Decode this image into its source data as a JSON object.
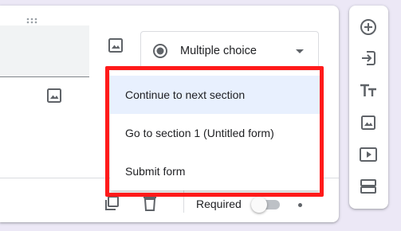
{
  "question": {
    "type_select": {
      "label": "Multiple choice"
    },
    "footer": {
      "required_label": "Required"
    }
  },
  "section_menu": {
    "items": [
      {
        "label": "Continue to next section",
        "selected": true
      },
      {
        "label": "Go to section 1 (Untitled form)",
        "selected": false
      },
      {
        "label": "Submit form",
        "selected": false
      }
    ]
  },
  "toolbar": {
    "tools": [
      "add-question-icon",
      "import-questions-icon",
      "add-title-icon",
      "add-image-icon",
      "add-video-icon",
      "add-section-icon"
    ]
  },
  "colors": {
    "background": "#ece8f6",
    "highlight": "#ff1a1a",
    "selected_item": "#e8f0fe",
    "icon": "#5f6368"
  }
}
